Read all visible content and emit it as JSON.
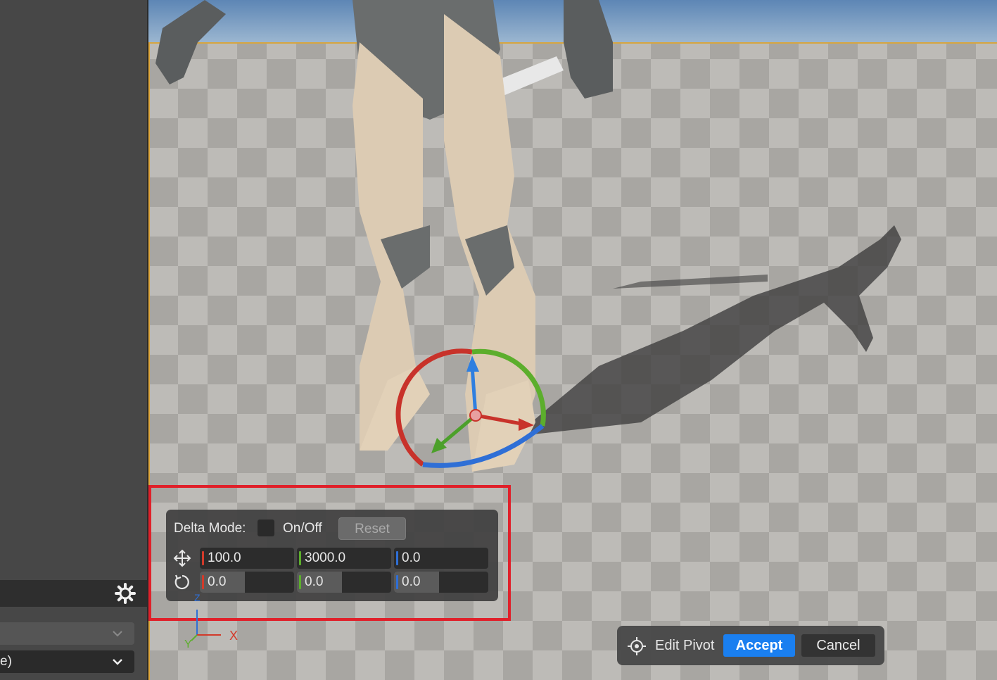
{
  "transform_panel": {
    "delta_mode_label": "Delta Mode:",
    "on_off_label": "On/Off",
    "reset_label": "Reset",
    "location": {
      "x": "100.0",
      "y": "3000.0",
      "z": "0.0"
    },
    "rotation": {
      "x": "0.0",
      "y": "0.0",
      "z": "0.0"
    },
    "location_icon": "move-arrows-icon",
    "rotation_icon": "rotate-icon"
  },
  "pivot_bar": {
    "icon": "crosshair-icon",
    "edit_pivot_label": "Edit Pivot",
    "accept_label": "Accept",
    "cancel_label": "Cancel"
  },
  "left_panel": {
    "dropdown_text": "e)",
    "settings_icon": "gear-icon"
  },
  "axis_indicator": {
    "z_label": "Z",
    "y_label": "Y",
    "x_label": "X"
  },
  "colors": {
    "accent_blue": "#1a7ff0",
    "axis_x": "#d23a2a",
    "axis_y": "#5cae2c",
    "axis_z": "#2f6fd6",
    "highlight_red": "#e0202a",
    "selection_orange": "#e0a83a"
  }
}
